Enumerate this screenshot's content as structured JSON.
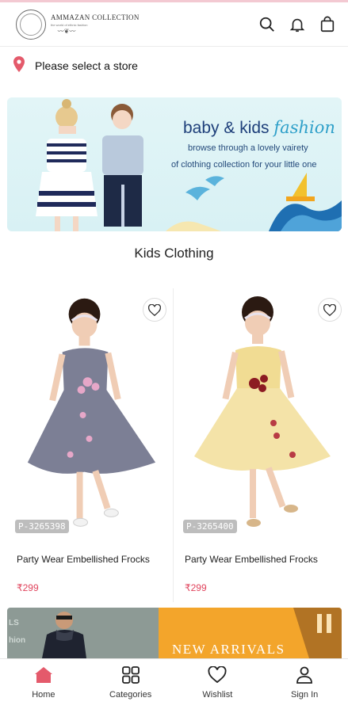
{
  "header": {
    "logo_name": "AMMAZAN COLLECTION",
    "logo_tagline": "the world of ethnic fashion",
    "icons": [
      "search-icon",
      "bell-icon",
      "bag-icon"
    ]
  },
  "store": {
    "text": "Please select a store",
    "icon": "location-pin-icon",
    "accent": "#e45a6b"
  },
  "banner": {
    "title_main": "baby & kids",
    "title_script": "fashion",
    "line1": "browse through a lovely vairety",
    "line2": "of clothing collection for your little one"
  },
  "section": {
    "title": "Kids Clothing"
  },
  "products": [
    {
      "code": "P-3265398",
      "name": "Party Wear Embellished Frocks",
      "price": "₹299",
      "dress_color": "#7c7f95"
    },
    {
      "code": "P-3265400",
      "name": "Party Wear Embellished Frocks",
      "price": "₹299",
      "dress_color": "#f1dc93"
    }
  ],
  "promo": {
    "text": "NEW ARRIVALS",
    "side_text": "LS\nhion"
  },
  "bottom_nav": [
    {
      "label": "Home",
      "icon": "home-icon",
      "active": true
    },
    {
      "label": "Categories",
      "icon": "grid-icon",
      "active": false
    },
    {
      "label": "Wishlist",
      "icon": "heart-icon",
      "active": false
    },
    {
      "label": "Sign In",
      "icon": "user-icon",
      "active": false
    }
  ],
  "colors": {
    "accent": "#e45a6b",
    "price": "#e0435c",
    "banner_title": "#1e3f7a"
  }
}
